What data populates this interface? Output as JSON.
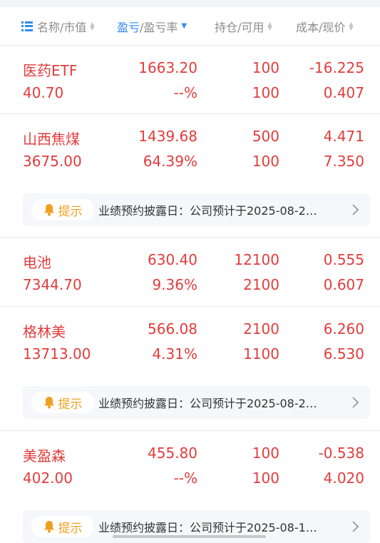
{
  "header": {
    "col1_label": "名称/市值",
    "col2_label_a": "盈亏",
    "col2_label_b": "/盈亏率",
    "col3_label": "持仓/可用",
    "col4_label": "成本/现价"
  },
  "colors": {
    "accent": "#2d8cf0",
    "profit": "#e23c3c",
    "notice_tag": "#f0a020",
    "muted": "#8c8c8c"
  },
  "holdings": [
    {
      "name": "医药ETF",
      "market_value": "40.70",
      "pnl": "1663.20",
      "pnl_rate": "--%",
      "position": "100",
      "available": "100",
      "cost": "-16.225",
      "price": "0.407"
    },
    {
      "name": "山西焦煤",
      "market_value": "3675.00",
      "pnl": "1439.68",
      "pnl_rate": "64.39%",
      "position": "500",
      "available": "100",
      "cost": "4.471",
      "price": "7.350"
    },
    {
      "name": "电池",
      "market_value": "7344.70",
      "pnl": "630.40",
      "pnl_rate": "9.36%",
      "position": "12100",
      "available": "2100",
      "cost": "0.555",
      "price": "0.607"
    },
    {
      "name": "格林美",
      "market_value": "13713.00",
      "pnl": "566.08",
      "pnl_rate": "4.31%",
      "position": "2100",
      "available": "1100",
      "cost": "6.260",
      "price": "6.530"
    },
    {
      "name": "美盈森",
      "market_value": "402.00",
      "pnl": "455.80",
      "pnl_rate": "--%",
      "position": "100",
      "available": "100",
      "cost": "-0.538",
      "price": "4.020"
    }
  ],
  "notices": [
    {
      "tag": "提示",
      "text": "业绩预约披露日：公司预计于2025-08-2…",
      "icon": "bell-icon",
      "chevron": "chevron-right-icon"
    },
    {
      "tag": "提示",
      "text": "业绩预约披露日：公司预计于2025-08-2…",
      "icon": "bell-icon",
      "chevron": "chevron-right-icon"
    },
    {
      "tag": "提示",
      "text": "业绩预约披露日：公司预计于2025-08-1…",
      "icon": "bell-icon",
      "chevron": "chevron-right-icon"
    }
  ]
}
